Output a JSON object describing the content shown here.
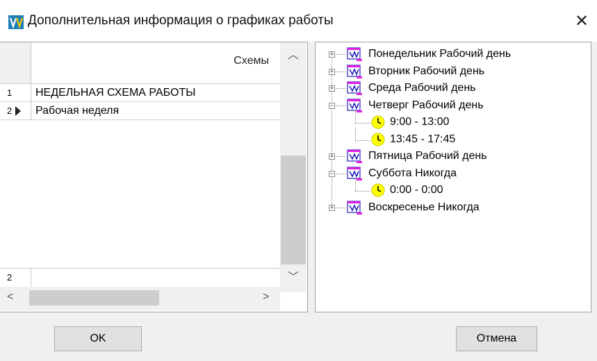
{
  "window": {
    "title": "Дополнительная информация о графиках работы",
    "app_icon": "app-logo-icon",
    "close_glyph": "✕"
  },
  "grid": {
    "column_header": "Схемы",
    "rows": [
      {
        "num": "1",
        "value": "НЕДЕЛЬНАЯ СХЕМА РАБОТЫ",
        "current": false
      },
      {
        "num": "2",
        "value": "Рабочая неделя",
        "current": true
      }
    ],
    "footer_num": "2"
  },
  "tree": {
    "nodes": [
      {
        "label": "Понедельник Рабочий день",
        "icon": "calendar-icon",
        "expander": "+"
      },
      {
        "label": "Вторник Рабочий день",
        "icon": "calendar-icon",
        "expander": "+"
      },
      {
        "label": "Среда Рабочий день",
        "icon": "calendar-icon",
        "expander": "+"
      },
      {
        "label": "Четверг Рабочий день",
        "icon": "calendar-icon",
        "expander": "−"
      },
      {
        "label": "9:00 - 13:00",
        "icon": "clock-icon"
      },
      {
        "label": "13:45 - 17:45",
        "icon": "clock-icon"
      },
      {
        "label": "Пятница Рабочий день",
        "icon": "calendar-icon",
        "expander": "+"
      },
      {
        "label": "Суббота Никогда",
        "icon": "calendar-icon",
        "expander": "−"
      },
      {
        "label": "0:00 - 0:00",
        "icon": "clock-icon"
      },
      {
        "label": "Воскресенье Никогда",
        "icon": "calendar-icon",
        "expander": "+"
      }
    ]
  },
  "buttons": {
    "ok": "OK",
    "cancel": "Отмена"
  },
  "colors": {
    "clock_yellow": "#ffff00",
    "calendar_magenta": "#e020e0",
    "calendar_blue": "#2020c0"
  }
}
